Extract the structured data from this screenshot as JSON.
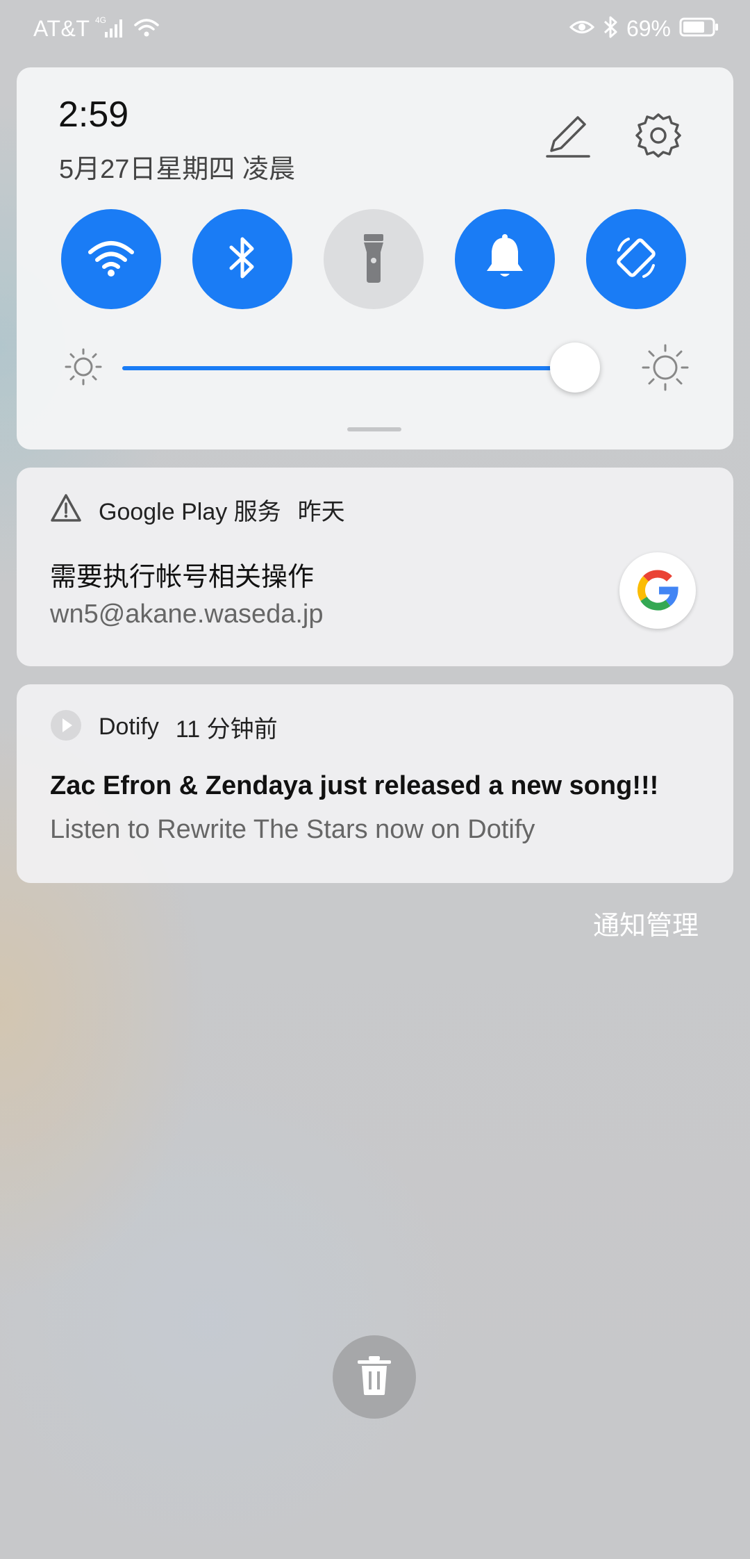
{
  "status_bar": {
    "carrier": "AT&T",
    "network": "4G",
    "battery_percent": "69%",
    "icons": [
      "signal-icon",
      "wifi-icon",
      "eye-icon",
      "bluetooth-icon",
      "battery-icon"
    ]
  },
  "quick_settings": {
    "time": "2:59",
    "date": "5月27日星期四 凌晨",
    "toggles": [
      {
        "name": "wifi",
        "on": true
      },
      {
        "name": "bluetooth",
        "on": true
      },
      {
        "name": "flashlight",
        "on": false
      },
      {
        "name": "sound",
        "on": true
      },
      {
        "name": "auto-rotate",
        "on": true
      }
    ],
    "brightness": 0.95,
    "accent_color": "#1a7cf5"
  },
  "notifications": [
    {
      "app": "Google Play 服务",
      "time": "昨天",
      "title": "需要执行帐号相关操作",
      "body": "wn5@akane.waseda.jp"
    },
    {
      "app": "Dotify",
      "time": "11 分钟前",
      "title": "Zac Efron & Zendaya just released a new song!!!",
      "body": "Listen to Rewrite The Stars now on Dotify"
    }
  ],
  "manage_label": "通知管理"
}
